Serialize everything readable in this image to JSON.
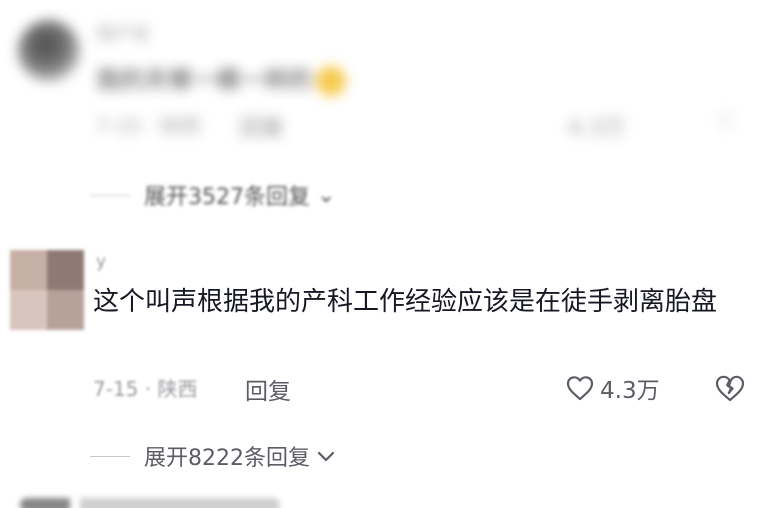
{
  "comment1": {
    "avatar": "avatar",
    "username": "用户名",
    "text": "我的天哪一模一样的",
    "meta": "7-15 · 陕西",
    "reply_label": "回复",
    "like_count": "4.3万",
    "expand_label": "展开3527条回复"
  },
  "comment2": {
    "username": "y",
    "text": "这个叫声根据我的产科工作经验应该是在徒手剥离胎盘",
    "meta": "7-15 · 陕西",
    "reply_label": "回复",
    "like_count": "4.3万",
    "like_icon": "heart-outline-icon",
    "dislike_icon": "broken-heart-icon",
    "expand_label": "展开8222条回复",
    "expand_icon": "chevron-down-icon"
  },
  "colors": {
    "text_primary": "#161823",
    "text_secondary": "#5c5c66",
    "text_muted": "#9a9aa0"
  }
}
